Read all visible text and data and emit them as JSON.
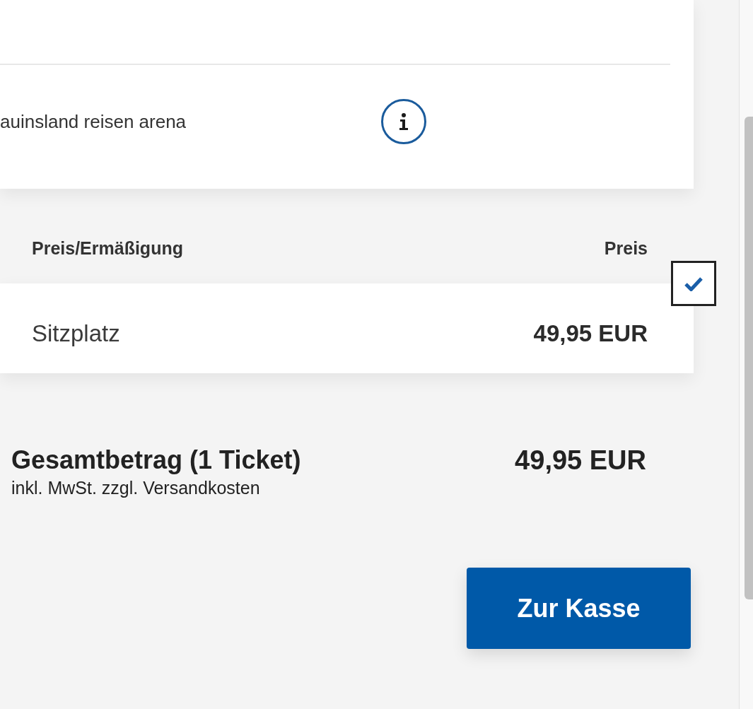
{
  "venue": {
    "name": "auinsland reisen arena"
  },
  "price_table": {
    "columns": [
      "Preis/Ermäßigung",
      "Preis"
    ],
    "rows": [
      {
        "category": "Sitzplatz",
        "price": "49,95 EUR",
        "checked": true
      }
    ]
  },
  "total": {
    "label": "Gesamtbetrag (1 Ticket)",
    "note": "inkl. MwSt. zzgl. Versandkosten",
    "amount": "49,95 EUR"
  },
  "checkout_button": {
    "label": "Zur Kasse"
  }
}
